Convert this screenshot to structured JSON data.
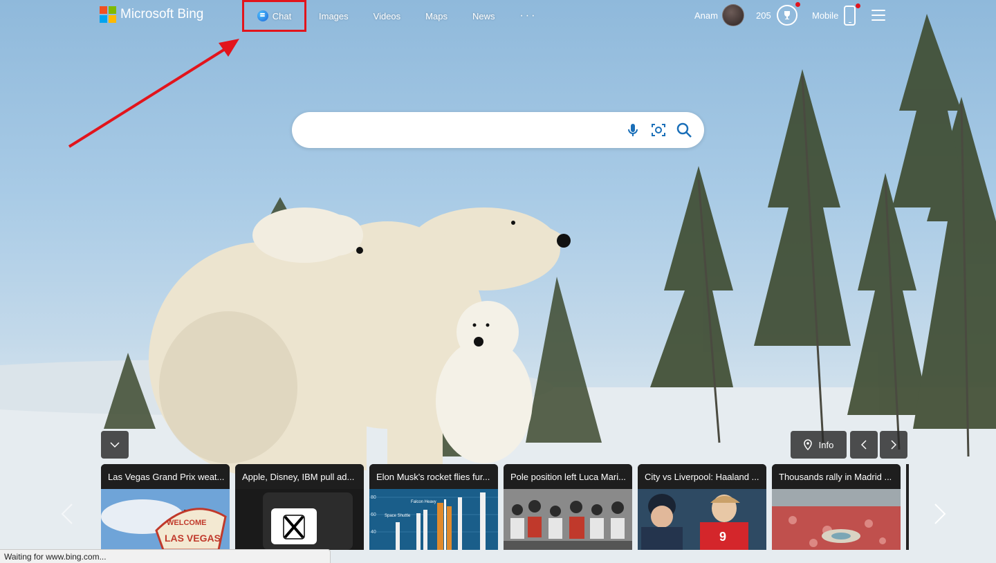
{
  "header": {
    "logo_text": "Microsoft Bing",
    "nav": [
      {
        "label": "Chat",
        "icon": "chat-icon"
      },
      {
        "label": "Images"
      },
      {
        "label": "Videos"
      },
      {
        "label": "Maps"
      },
      {
        "label": "News"
      },
      {
        "label": "···"
      }
    ],
    "user_name": "Anam",
    "rewards_points": "205",
    "mobile_label": "Mobile"
  },
  "search": {
    "value": "",
    "placeholder": ""
  },
  "carousel": {
    "info_label": "Info",
    "cards": [
      {
        "title": "Las Vegas Grand Prix weat..."
      },
      {
        "title": "Apple, Disney, IBM pull ad..."
      },
      {
        "title": "Elon Musk's rocket flies fur..."
      },
      {
        "title": "Pole position left Luca Mari..."
      },
      {
        "title": "City vs Liverpool: Haaland ..."
      },
      {
        "title": "Thousands rally in Madrid ..."
      }
    ],
    "rocket_chart": {
      "labels": [
        "Falcon Heavy",
        "Space Shuttle"
      ],
      "y_ticks": [
        "80",
        "60",
        "40"
      ]
    },
    "vegas_sign": {
      "line1": "WELCOME",
      "line2": "LAS VEGAS"
    }
  },
  "status_bar": {
    "text": "Waiting for www.bing.com..."
  },
  "colors": {
    "annotation_red": "#e2141c",
    "search_icon_blue": "#1a6fb8"
  }
}
